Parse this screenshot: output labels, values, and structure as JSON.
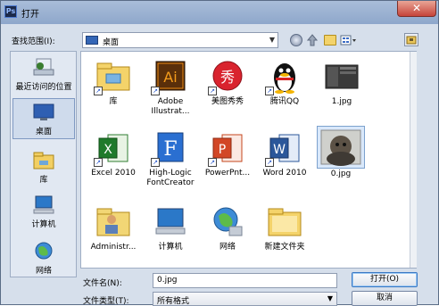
{
  "window": {
    "title": "打开",
    "close_glyph": "✕",
    "app_icon_text": "Ps"
  },
  "toolbar": {
    "look_in_label": "查找范围(I):",
    "look_in_value": "桌面"
  },
  "places": [
    {
      "label": "最近访问的位置",
      "icon": "recent-places-icon"
    },
    {
      "label": "桌面",
      "icon": "desktop-icon",
      "selected": true
    },
    {
      "label": "库",
      "icon": "libraries-icon"
    },
    {
      "label": "计算机",
      "icon": "computer-icon"
    },
    {
      "label": "网络",
      "icon": "network-icon"
    }
  ],
  "files": [
    {
      "label": "库",
      "icon": "libraries-folder-icon"
    },
    {
      "label": "Adobe Illustrat...",
      "icon": "illustrator-icon",
      "tile_text": "Ai"
    },
    {
      "label": "美图秀秀",
      "icon": "meitu-icon",
      "tile_text": "秀"
    },
    {
      "label": "腾讯QQ",
      "icon": "qq-penguin-icon"
    },
    {
      "label": "1.jpg",
      "icon": "image-thumbnail-icon"
    },
    {
      "label": "Excel 2010",
      "icon": "excel-icon",
      "tile_text": "X"
    },
    {
      "label": "High-Logic FontCreator",
      "icon": "fontcreator-icon",
      "tile_text": "F"
    },
    {
      "label": "PowerPnt...",
      "icon": "powerpoint-icon",
      "tile_text": "P"
    },
    {
      "label": "Word 2010",
      "icon": "word-icon",
      "tile_text": "W"
    },
    {
      "label": "0.jpg",
      "icon": "photo-thumbnail-icon",
      "selected": true
    },
    {
      "label": "Administr...",
      "icon": "user-folder-icon"
    },
    {
      "label": "计算机",
      "icon": "computer-icon"
    },
    {
      "label": "网络",
      "icon": "network-icon"
    },
    {
      "label": "新建文件夹",
      "icon": "folder-icon"
    }
  ],
  "footer": {
    "filename_label": "文件名(N):",
    "filename_value": "0.jpg",
    "filetype_label": "文件类型(T):",
    "filetype_value": "所有格式",
    "open_label": "打开(O)",
    "cancel_label": "取消"
  }
}
